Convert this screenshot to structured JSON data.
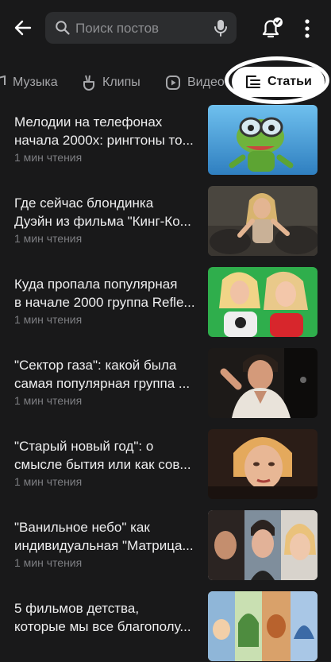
{
  "header": {
    "search_placeholder": "Поиск постов",
    "icons": [
      "back-arrow-icon",
      "search-icon",
      "microphone-icon",
      "bell-check-icon",
      "more-vertical-icon"
    ]
  },
  "tabs": [
    {
      "label": "Музыка",
      "icon": "music-icon"
    },
    {
      "label": "Клипы",
      "icon": "clips-icon"
    },
    {
      "label": "Видео",
      "icon": "video-icon"
    },
    {
      "label": "Статьи",
      "icon": "articles-icon",
      "selected": true
    }
  ],
  "articles": [
    {
      "line1": "Мелодии на телефонах",
      "line2": "начала 2000х: рингтоны то...",
      "meta": "1 мин чтения"
    },
    {
      "line1": "Где сейчас блондинка",
      "line2": "Дуэйн из фильма \"Кинг-Ко...",
      "meta": "1 мин чтения"
    },
    {
      "line1": "Куда пропала популярная",
      "line2": "в начале 2000 группа Refle...",
      "meta": "1 мин чтения"
    },
    {
      "line1": "\"Сектор газа\": какой была",
      "line2": "самая популярная группа ...",
      "meta": "1 мин чтения"
    },
    {
      "line1": "\"Старый новый год\": о",
      "line2": "смысле бытия или как сов...",
      "meta": "1 мин чтения"
    },
    {
      "line1": "\"Ванильное небо\" как",
      "line2": "индивидуальная \"Матрица...",
      "meta": "1 мин чтения"
    },
    {
      "line1": "5 фильмов детства,",
      "line2": "которые мы все благополу...",
      "meta": ""
    }
  ],
  "colors": {
    "background": "#19191a",
    "search_bg": "#2c2d2f",
    "active_tab_bg": "#ffffff",
    "muted_text": "#7d7e82"
  }
}
